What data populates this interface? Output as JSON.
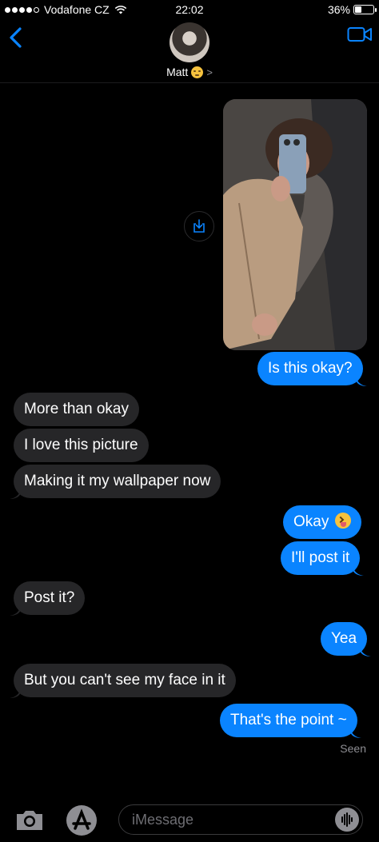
{
  "status_bar": {
    "carrier": "Vodafone CZ",
    "signal_bars_filled": 4,
    "signal_bars_total": 5,
    "time": "22:02",
    "battery_percent_label": "36%",
    "battery_level": 0.36
  },
  "header": {
    "contact_name": "Matt",
    "contact_emoji": "unamused-face-icon",
    "back_icon": "chevron-left-icon",
    "video_icon": "video-camera-icon",
    "accent_color": "#0a84ff"
  },
  "attachment": {
    "type": "photo",
    "save_icon": "save-to-device-icon"
  },
  "messages": [
    {
      "side": "sent",
      "text": "Is this okay?"
    },
    {
      "side": "received",
      "text": "More than okay"
    },
    {
      "side": "received",
      "text": "I love this picture"
    },
    {
      "side": "received",
      "text": "Making it my wallpaper now"
    },
    {
      "side": "sent",
      "text": "Okay",
      "emoji": "squinting-tongue-face-icon"
    },
    {
      "side": "sent",
      "text": "I'll post it"
    },
    {
      "side": "received",
      "text": "Post it?"
    },
    {
      "side": "sent",
      "text": "Yea"
    },
    {
      "side": "received",
      "text": "But you can't see my face in it"
    },
    {
      "side": "sent",
      "text": "That's the point ~"
    }
  ],
  "read_receipt": "Seen",
  "input_bar": {
    "placeholder": "iMessage",
    "camera_icon": "camera-icon",
    "apps_icon": "app-store-icon",
    "audio_icon": "audio-waveform-icon"
  },
  "colors": {
    "sent_bubble": "#0a84ff",
    "received_bubble": "#262628",
    "background": "#000000"
  }
}
